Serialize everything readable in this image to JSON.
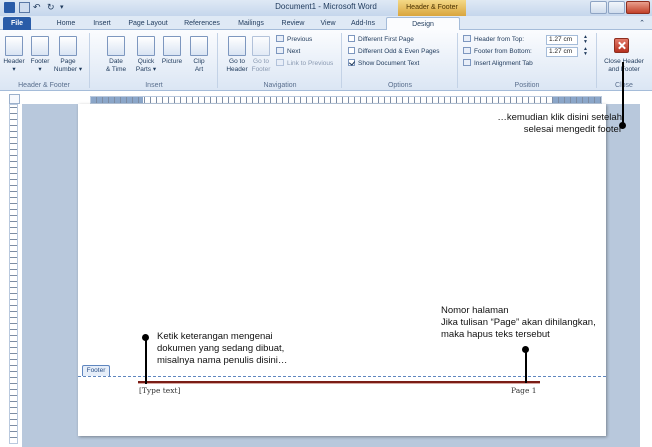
{
  "window": {
    "title": "Document1 - Microsoft Word",
    "contextual_tab": "Header & Footer Tools"
  },
  "tabs": [
    "File",
    "Home",
    "Insert",
    "Page Layout",
    "References",
    "Mailings",
    "Review",
    "View",
    "Add-Ins",
    "Design"
  ],
  "ribbon": {
    "groups": [
      {
        "label": "Header & Footer",
        "buttons": [
          "Header\n▾",
          "Footer\n▾",
          "Page\nNumber ▾"
        ]
      },
      {
        "label": "Insert",
        "buttons": [
          "Date\n& Time",
          "Quick\nParts ▾",
          "Picture",
          "Clip\nArt"
        ]
      },
      {
        "label": "Navigation",
        "buttons": [
          "Go to\nHeader",
          "Go to\nFooter"
        ],
        "small": [
          "Previous",
          "Next",
          "Link to Previous"
        ]
      },
      {
        "label": "Options",
        "checks": [
          {
            "label": "Different First Page",
            "checked": false
          },
          {
            "label": "Different Odd & Even Pages",
            "checked": false
          },
          {
            "label": "Show Document Text",
            "checked": true
          }
        ]
      },
      {
        "label": "Position",
        "header_from_top_label": "Header from Top:",
        "header_from_top_value": "1.27 cm",
        "footer_from_bottom_label": "Footer from Bottom:",
        "footer_from_bottom_value": "1.27 cm",
        "insert_alignment_tab": "Insert Alignment Tab"
      },
      {
        "label": "Close",
        "button": "Close Header\nand Footer"
      }
    ]
  },
  "document": {
    "footer_tag": "Footer",
    "footer_left_text": "[Type text]",
    "footer_right_text": "Page 1"
  },
  "annotations": {
    "close_note_line1": "…kemudian klik disini setelah",
    "close_note_line2": "selesai mengedit footer",
    "page_note_line1": "Nomor halaman",
    "page_note_line2": "Jika tulisan “Page” akan dihilangkan,",
    "page_note_line3": "maka hapus teks tersebut",
    "text_note_line1": "Ketik keterangan mengenai",
    "text_note_line2": "dokumen yang sedang dibuat,",
    "text_note_line3": "misalnya nama penulis disini…"
  }
}
